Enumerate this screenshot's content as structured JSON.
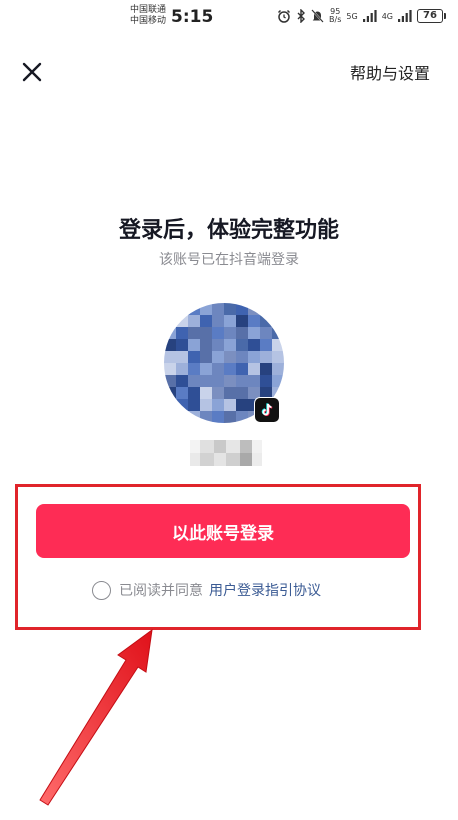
{
  "status_bar": {
    "carrier_1": "中国联通",
    "carrier_2": "中国移动",
    "time": "5:15",
    "speed_value": "95",
    "speed_unit": "B/s",
    "net_1": "5G",
    "net_2": "4G",
    "battery": "76"
  },
  "header": {
    "help_label": "帮助与设置"
  },
  "main": {
    "title": "登录后，体验完整功能",
    "subtitle": "该账号已在抖音端登录",
    "login_button": "以此账号登录",
    "agree_text": "已阅读并同意",
    "agree_link": "用户登录指引协议"
  },
  "colors": {
    "accent": "#fe2c55",
    "link": "#3b5b94",
    "annotation": "#e0242a"
  },
  "icons": {
    "close": "close-icon",
    "badge": "tiktok-logo-icon"
  }
}
